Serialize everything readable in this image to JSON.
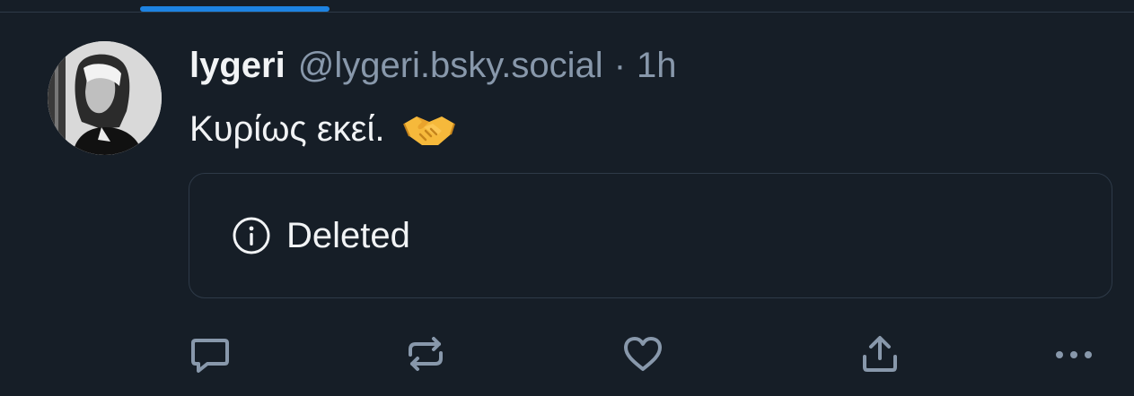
{
  "tabs": {
    "active_color": "#1d83e2"
  },
  "post": {
    "author": {
      "display_name": "lygeri",
      "handle": "@lygeri.bsky.social",
      "avatar": "avatar-photo"
    },
    "separator": "·",
    "timestamp": "1h",
    "text": "Κυρίως εκεί.",
    "emoji": "handshake-emoji",
    "quote": {
      "icon": "info-circle-icon",
      "status": "Deleted"
    }
  },
  "actions": [
    {
      "name": "reply",
      "icon": "reply-icon"
    },
    {
      "name": "repost",
      "icon": "repost-icon"
    },
    {
      "name": "like",
      "icon": "heart-icon"
    },
    {
      "name": "share",
      "icon": "share-icon"
    },
    {
      "name": "more",
      "icon": "more-icon"
    }
  ],
  "colors": {
    "background": "#161e27",
    "border": "#2e3a48",
    "text_primary": "#f1f3f5",
    "text_secondary": "#8898ab",
    "icon": "#8898ab"
  }
}
